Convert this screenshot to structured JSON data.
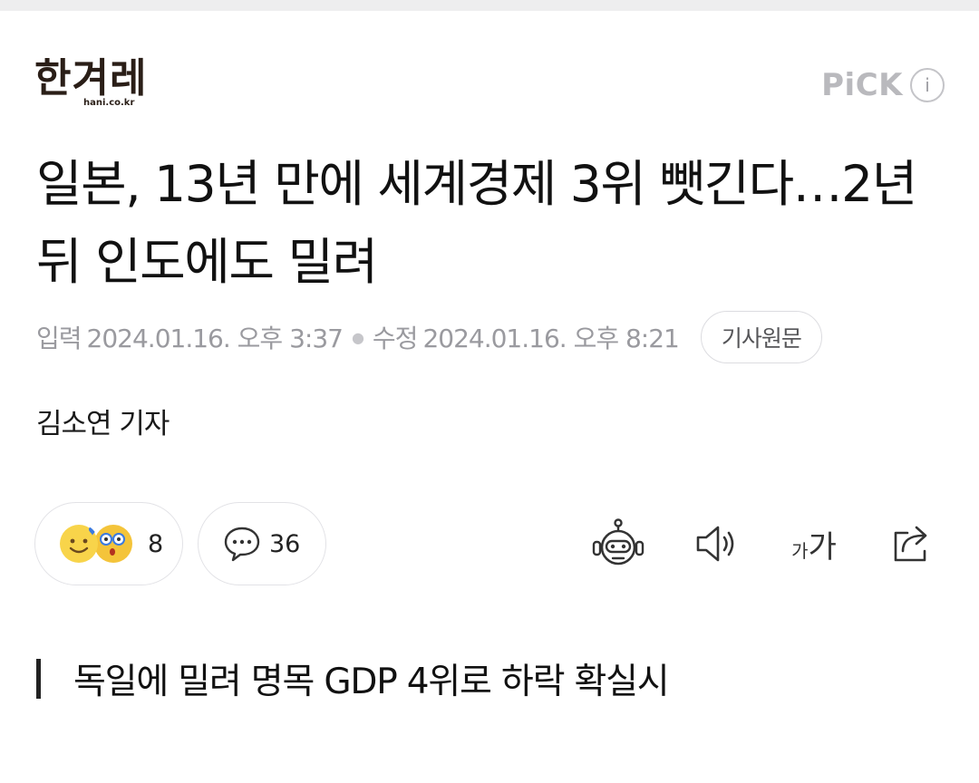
{
  "press": {
    "logo_text": "한겨레",
    "logo_sub": "hani.co.kr"
  },
  "pick": {
    "label": "PiCK",
    "info_icon_label": "i"
  },
  "article": {
    "headline": "일본, 13년 만에 세계경제 3위 뺏긴다…2년 뒤 인도에도 밀려",
    "input_label": "입력",
    "input_datetime": "2024.01.16. 오후 3:37",
    "modified_label": "수정",
    "modified_datetime": "2024.01.16. 오후 8:21",
    "origin_button": "기사원문",
    "reporter": "김소연 기자",
    "subheading": "독일에 밀려 명목 GDP 4위로 하락 확실시"
  },
  "engagement": {
    "reaction_count": "8",
    "comment_count": "36"
  },
  "tools": {
    "font_small": "가",
    "font_big": "가"
  },
  "icons": {
    "reaction_emojis": [
      "smile-heart-emoji",
      "surprised-glasses-emoji"
    ],
    "comment": "speech-bubble-icon",
    "summary_bot": "robot-icon",
    "tts": "speaker-icon",
    "font_size": "font-size-icon",
    "share": "share-icon"
  },
  "colors": {
    "logo": "#2a1e17",
    "pick": "#b9b9bd",
    "meta_text": "#9a9a9f",
    "emoji_yellow": "#f8d44a"
  }
}
